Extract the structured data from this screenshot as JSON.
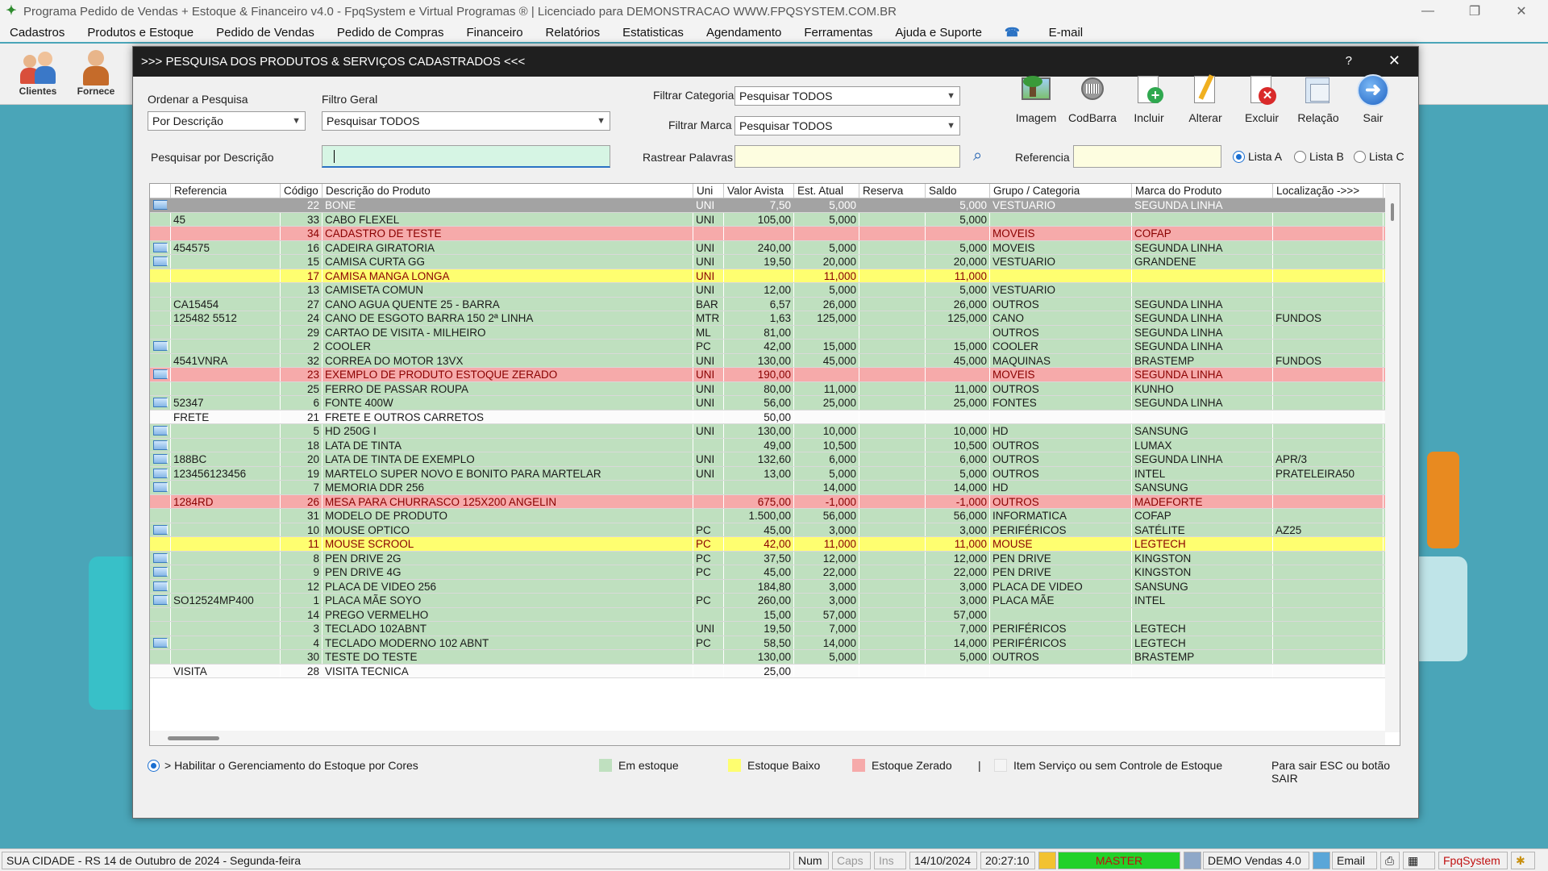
{
  "app": {
    "title": "Programa Pedido de Vendas + Estoque & Financeiro v4.0 - FpqSystem e Virtual Programas ® | Licenciado para  DEMONSTRACAO WWW.FPQSYSTEM.COM.BR",
    "menu": [
      "Cadastros",
      "Produtos e Estoque",
      "Pedido de Vendas",
      "Pedido de Compras",
      "Financeiro",
      "Relatórios",
      "Estatisticas",
      "Agendamento",
      "Ferramentas",
      "Ajuda e Suporte",
      "E-mail"
    ],
    "toolbar": [
      "Clientes",
      "Fornece"
    ]
  },
  "dialog": {
    "title": ">>>  PESQUISA DOS PRODUTOS & SERVIÇOS CADASTRADOS  <<<",
    "help": "?",
    "close": "✕",
    "order_label": "Ordenar a Pesquisa",
    "order_value": "Por Descrição",
    "filter_label": "Filtro Geral",
    "filter_value": "Pesquisar TODOS",
    "category_label": "Filtrar Categoria",
    "category_value": "Pesquisar TODOS",
    "brand_label": "Filtrar Marca",
    "brand_value": "Pesquisar TODOS",
    "search_label": "Pesquisar por Descrição",
    "search_value": "",
    "track_label": "Rastrear Palavras",
    "track_value": "",
    "ref_label": "Referencia",
    "ref_value": "",
    "list_a": "Lista A",
    "list_b": "Lista B",
    "list_c": "Lista C",
    "actions": [
      "Imagem",
      "CodBarra",
      "Incluir",
      "Alterar",
      "Excluir",
      "Relação",
      "Sair"
    ]
  },
  "grid": {
    "headers": [
      "Referencia",
      "Código",
      "Descrição do Produto",
      "Uni",
      "Valor Avista",
      "Est. Atual",
      "Reserva",
      "Saldo",
      "Grupo / Categoria",
      "Marca do Produto",
      "Localização  ->>>"
    ],
    "rows": [
      {
        "img": true,
        "ref": "",
        "cod": "22",
        "desc": "BONE",
        "uni": "UNI",
        "valor": "7,50",
        "est": "5,000",
        "res": "",
        "saldo": "5,000",
        "grupo": "VESTUARIO",
        "marca": "SEGUNDA LINHA",
        "loc": "",
        "style": "sel"
      },
      {
        "img": false,
        "ref": "45",
        "cod": "33",
        "desc": "CABO FLEXEL",
        "uni": "UNI",
        "valor": "105,00",
        "est": "5,000",
        "res": "",
        "saldo": "5,000",
        "grupo": "",
        "marca": "",
        "loc": "",
        "style": "green"
      },
      {
        "img": false,
        "ref": "",
        "cod": "34",
        "desc": "CADASTRO DE TESTE",
        "uni": "",
        "valor": "",
        "est": "",
        "res": "",
        "saldo": "",
        "grupo": "MOVEIS",
        "marca": "COFAP",
        "loc": "",
        "style": "red"
      },
      {
        "img": true,
        "ref": "454575",
        "cod": "16",
        "desc": "CADEIRA GIRATORIA",
        "uni": "UNI",
        "valor": "240,00",
        "est": "5,000",
        "res": "",
        "saldo": "5,000",
        "grupo": "MOVEIS",
        "marca": "SEGUNDA LINHA",
        "loc": "",
        "style": "green"
      },
      {
        "img": true,
        "ref": "",
        "cod": "15",
        "desc": "CAMISA CURTA GG",
        "uni": "UNI",
        "valor": "19,50",
        "est": "20,000",
        "res": "",
        "saldo": "20,000",
        "grupo": "VESTUARIO",
        "marca": "GRANDENE",
        "loc": "",
        "style": "green"
      },
      {
        "img": false,
        "ref": "",
        "cod": "17",
        "desc": "CAMISA MANGA LONGA",
        "uni": "UNI",
        "valor": "",
        "est": "11,000",
        "res": "",
        "saldo": "11,000",
        "grupo": "",
        "marca": "",
        "loc": "",
        "style": "yellow"
      },
      {
        "img": false,
        "ref": "",
        "cod": "13",
        "desc": "CAMISETA COMUN",
        "uni": "UNI",
        "valor": "12,00",
        "est": "5,000",
        "res": "",
        "saldo": "5,000",
        "grupo": "VESTUARIO",
        "marca": "",
        "loc": "",
        "style": "green"
      },
      {
        "img": false,
        "ref": "CA15454",
        "cod": "27",
        "desc": "CANO AGUA QUENTE 25 - BARRA",
        "uni": "BAR",
        "valor": "6,57",
        "est": "26,000",
        "res": "",
        "saldo": "26,000",
        "grupo": "OUTROS",
        "marca": "SEGUNDA LINHA",
        "loc": "",
        "style": "green"
      },
      {
        "img": false,
        "ref": "125482 5512",
        "cod": "24",
        "desc": "CANO DE ESGOTO BARRA 150 2ª LINHA",
        "uni": "MTR",
        "valor": "1,63",
        "est": "125,000",
        "res": "",
        "saldo": "125,000",
        "grupo": "CANO",
        "marca": "SEGUNDA LINHA",
        "loc": "FUNDOS",
        "style": "green"
      },
      {
        "img": false,
        "ref": "",
        "cod": "29",
        "desc": "CARTAO DE VISITA - MILHEIRO",
        "uni": "ML",
        "valor": "81,00",
        "est": "",
        "res": "",
        "saldo": "",
        "grupo": "OUTROS",
        "marca": "SEGUNDA LINHA",
        "loc": "",
        "style": "green"
      },
      {
        "img": true,
        "ref": "",
        "cod": "2",
        "desc": "COOLER",
        "uni": "PC",
        "valor": "42,00",
        "est": "15,000",
        "res": "",
        "saldo": "15,000",
        "grupo": "COOLER",
        "marca": "SEGUNDA LINHA",
        "loc": "",
        "style": "green"
      },
      {
        "img": false,
        "ref": "4541VNRA",
        "cod": "32",
        "desc": "CORREA DO MOTOR 13VX",
        "uni": "UNI",
        "valor": "130,00",
        "est": "45,000",
        "res": "",
        "saldo": "45,000",
        "grupo": "MAQUINAS",
        "marca": "BRASTEMP",
        "loc": "FUNDOS",
        "style": "green"
      },
      {
        "img": true,
        "ref": "",
        "cod": "23",
        "desc": "EXEMPLO DE PRODUTO ESTOQUE ZERADO",
        "uni": "UNI",
        "valor": "190,00",
        "est": "",
        "res": "",
        "saldo": "",
        "grupo": "MOVEIS",
        "marca": "SEGUNDA LINHA",
        "loc": "",
        "style": "red"
      },
      {
        "img": false,
        "ref": "",
        "cod": "25",
        "desc": "FERRO DE PASSAR ROUPA",
        "uni": "UNI",
        "valor": "80,00",
        "est": "11,000",
        "res": "",
        "saldo": "11,000",
        "grupo": "OUTROS",
        "marca": "KUNHO",
        "loc": "",
        "style": "green"
      },
      {
        "img": true,
        "ref": "52347",
        "cod": "6",
        "desc": "FONTE 400W",
        "uni": "UNI",
        "valor": "56,00",
        "est": "25,000",
        "res": "",
        "saldo": "25,000",
        "grupo": "FONTES",
        "marca": "SEGUNDA LINHA",
        "loc": "",
        "style": "green"
      },
      {
        "img": false,
        "ref": "FRETE",
        "cod": "21",
        "desc": "FRETE E OUTROS CARRETOS",
        "uni": "",
        "valor": "50,00",
        "est": "",
        "res": "",
        "saldo": "",
        "grupo": "",
        "marca": "",
        "loc": "",
        "style": "white"
      },
      {
        "img": true,
        "ref": "",
        "cod": "5",
        "desc": "HD 250G   I",
        "uni": "UNI",
        "valor": "130,00",
        "est": "10,000",
        "res": "",
        "saldo": "10,000",
        "grupo": "HD",
        "marca": "SANSUNG",
        "loc": "",
        "style": "green"
      },
      {
        "img": true,
        "ref": "",
        "cod": "18",
        "desc": "LATA DE TINTA",
        "uni": "",
        "valor": "49,00",
        "est": "10,500",
        "res": "",
        "saldo": "10,500",
        "grupo": "OUTROS",
        "marca": "LUMAX",
        "loc": "",
        "style": "green"
      },
      {
        "img": true,
        "ref": "188BC",
        "cod": "20",
        "desc": "LATA DE TINTA DE EXEMPLO",
        "uni": "UNI",
        "valor": "132,60",
        "est": "6,000",
        "res": "",
        "saldo": "6,000",
        "grupo": "OUTROS",
        "marca": "SEGUNDA LINHA",
        "loc": "APR/3",
        "style": "green"
      },
      {
        "img": true,
        "ref": "123456123456",
        "cod": "19",
        "desc": "MARTELO SUPER NOVO E BONITO PARA MARTELAR",
        "uni": "UNI",
        "valor": "13,00",
        "est": "5,000",
        "res": "",
        "saldo": "5,000",
        "grupo": "OUTROS",
        "marca": "INTEL",
        "loc": "PRATELEIRA50",
        "style": "green"
      },
      {
        "img": true,
        "ref": "",
        "cod": "7",
        "desc": "MEMORIA DDR 256",
        "uni": "",
        "valor": "",
        "est": "14,000",
        "res": "",
        "saldo": "14,000",
        "grupo": "HD",
        "marca": "SANSUNG",
        "loc": "",
        "style": "green"
      },
      {
        "img": false,
        "ref": "1284RD",
        "cod": "26",
        "desc": "MESA PARA CHURRASCO 125X200 ANGELIN",
        "uni": "",
        "valor": "675,00",
        "est": "-1,000",
        "res": "",
        "saldo": "-1,000",
        "grupo": "OUTROS",
        "marca": "MADEFORTE",
        "loc": "",
        "style": "red"
      },
      {
        "img": false,
        "ref": "",
        "cod": "31",
        "desc": "MODELO DE PRODUTO",
        "uni": "",
        "valor": "1.500,00",
        "est": "56,000",
        "res": "",
        "saldo": "56,000",
        "grupo": "INFORMATICA",
        "marca": "COFAP",
        "loc": "",
        "style": "green"
      },
      {
        "img": true,
        "ref": "",
        "cod": "10",
        "desc": "MOUSE OPTICO",
        "uni": "PC",
        "valor": "45,00",
        "est": "3,000",
        "res": "",
        "saldo": "3,000",
        "grupo": "PERIFÉRICOS",
        "marca": "SATÉLITE",
        "loc": "AZ25",
        "style": "green"
      },
      {
        "img": false,
        "ref": "",
        "cod": "11",
        "desc": "MOUSE SCROOL",
        "uni": "PC",
        "valor": "42,00",
        "est": "11,000",
        "res": "",
        "saldo": "11,000",
        "grupo": "MOUSE",
        "marca": "LEGTECH",
        "loc": "",
        "style": "yellow"
      },
      {
        "img": true,
        "ref": "",
        "cod": "8",
        "desc": "PEN DRIVE 2G",
        "uni": "PC",
        "valor": "37,50",
        "est": "12,000",
        "res": "",
        "saldo": "12,000",
        "grupo": "PEN DRIVE",
        "marca": "KINGSTON",
        "loc": "",
        "style": "green"
      },
      {
        "img": true,
        "ref": "",
        "cod": "9",
        "desc": "PEN DRIVE 4G",
        "uni": "PC",
        "valor": "45,00",
        "est": "22,000",
        "res": "",
        "saldo": "22,000",
        "grupo": "PEN DRIVE",
        "marca": "KINGSTON",
        "loc": "",
        "style": "green"
      },
      {
        "img": true,
        "ref": "",
        "cod": "12",
        "desc": "PLACA DE VIDEO 256",
        "uni": "",
        "valor": "184,80",
        "est": "3,000",
        "res": "",
        "saldo": "3,000",
        "grupo": "PLACA DE VIDEO",
        "marca": "SANSUNG",
        "loc": "",
        "style": "green"
      },
      {
        "img": true,
        "ref": "SO12524MP400",
        "cod": "1",
        "desc": "PLACA MÃE SOYO",
        "uni": "PC",
        "valor": "260,00",
        "est": "3,000",
        "res": "",
        "saldo": "3,000",
        "grupo": "PLACA MÃE",
        "marca": "INTEL",
        "loc": "",
        "style": "green"
      },
      {
        "img": false,
        "ref": "",
        "cod": "14",
        "desc": "PREGO VERMELHO",
        "uni": "",
        "valor": "15,00",
        "est": "57,000",
        "res": "",
        "saldo": "57,000",
        "grupo": "",
        "marca": "",
        "loc": "",
        "style": "green"
      },
      {
        "img": false,
        "ref": "",
        "cod": "3",
        "desc": "TECLADO 102ABNT",
        "uni": "UNI",
        "valor": "19,50",
        "est": "7,000",
        "res": "",
        "saldo": "7,000",
        "grupo": "PERIFÉRICOS",
        "marca": "LEGTECH",
        "loc": "",
        "style": "green"
      },
      {
        "img": true,
        "ref": "",
        "cod": "4",
        "desc": "TECLADO MODERNO 102 ABNT",
        "uni": "PC",
        "valor": "58,50",
        "est": "14,000",
        "res": "",
        "saldo": "14,000",
        "grupo": "PERIFÉRICOS",
        "marca": "LEGTECH",
        "loc": "",
        "style": "green"
      },
      {
        "img": false,
        "ref": "",
        "cod": "30",
        "desc": "TESTE DO TESTE",
        "uni": "",
        "valor": "130,00",
        "est": "5,000",
        "res": "",
        "saldo": "5,000",
        "grupo": "OUTROS",
        "marca": "BRASTEMP",
        "loc": "",
        "style": "green"
      },
      {
        "img": false,
        "ref": "VISITA",
        "cod": "28",
        "desc": "VISITA TECNICA",
        "uni": "",
        "valor": "25,00",
        "est": "",
        "res": "",
        "saldo": "",
        "grupo": "",
        "marca": "",
        "loc": "",
        "style": "white"
      }
    ]
  },
  "legend": {
    "enable_colors": "> Habilitar o Gerenciamento do Estoque por Cores",
    "in_stock": "Em estoque",
    "low_stock": "Estoque Baixo",
    "zero_stock": "Estoque Zerado",
    "sep": "|",
    "service": "Item Serviço ou sem Controle de Estoque",
    "exit_hint": "Para sair ESC ou botão SAIR",
    "colors": {
      "green": "#bfe0bf",
      "yellow": "#fefe70",
      "red": "#f6aaaa",
      "white": "#f4f4f4"
    }
  },
  "status": {
    "city": "SUA CIDADE - RS 14 de Outubro de 2024 - Segunda-feira",
    "num": "Num",
    "caps": "Caps",
    "ins": "Ins",
    "date": "14/10/2024",
    "time": "20:27:10",
    "user": "MASTER",
    "version": "DEMO Vendas 4.0",
    "email": "Email",
    "brand": "FpqSystem"
  }
}
